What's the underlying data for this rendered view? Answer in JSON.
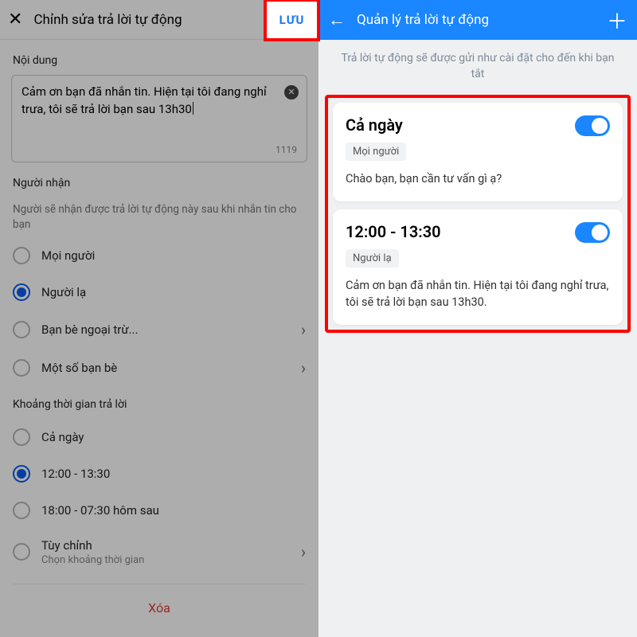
{
  "left": {
    "header_title": "Chỉnh sửa trả lời tự động",
    "save_label": "LƯU",
    "content_label": "Nội dung",
    "message_text": "Cảm ơn bạn đã nhắn tin. Hiện tại tôi đang nghỉ trưa, tôi sẽ trả lời bạn sau 13h30",
    "char_counter": "1119",
    "recipients_label": "Người nhận",
    "recipients_help": "Người sẽ nhận được trả lời tự động này sau khi nhắn tin cho bạn",
    "recipients": [
      {
        "label": "Mọi người",
        "selected": false,
        "chevron": false
      },
      {
        "label": "Người lạ",
        "selected": true,
        "chevron": false
      },
      {
        "label": "Bạn bè ngoại trừ...",
        "selected": false,
        "chevron": true
      },
      {
        "label": "Một số bạn bè",
        "selected": false,
        "chevron": true
      }
    ],
    "period_label": "Khoảng thời gian trả lời",
    "periods": [
      {
        "label": "Cả ngày",
        "selected": false,
        "chevron": false,
        "sub": ""
      },
      {
        "label": "12:00 - 13:30",
        "selected": true,
        "chevron": false,
        "sub": ""
      },
      {
        "label": "18:00 - 07:30 hôm sau",
        "selected": false,
        "chevron": false,
        "sub": ""
      },
      {
        "label": "Tùy chỉnh",
        "selected": false,
        "chevron": true,
        "sub": "Chọn khoảng thời gian"
      }
    ],
    "delete_label": "Xóa"
  },
  "right": {
    "header_title": "Quản lý trả lời tự động",
    "help_text": "Trả lời tự động sẽ được gửi như cài đặt cho đến khi bạn tắt",
    "cards": [
      {
        "title": "Cả ngày",
        "badge": "Mọi người",
        "body": "Chào bạn, bạn cần tư vấn gì ạ?",
        "on": true
      },
      {
        "title": "12:00 - 13:30",
        "badge": "Người lạ",
        "body": "Cảm ơn bạn đã nhắn tin. Hiện tại tôi đang nghỉ trưa, tôi sẽ trả lời bạn sau 13h30.",
        "on": true
      }
    ]
  }
}
